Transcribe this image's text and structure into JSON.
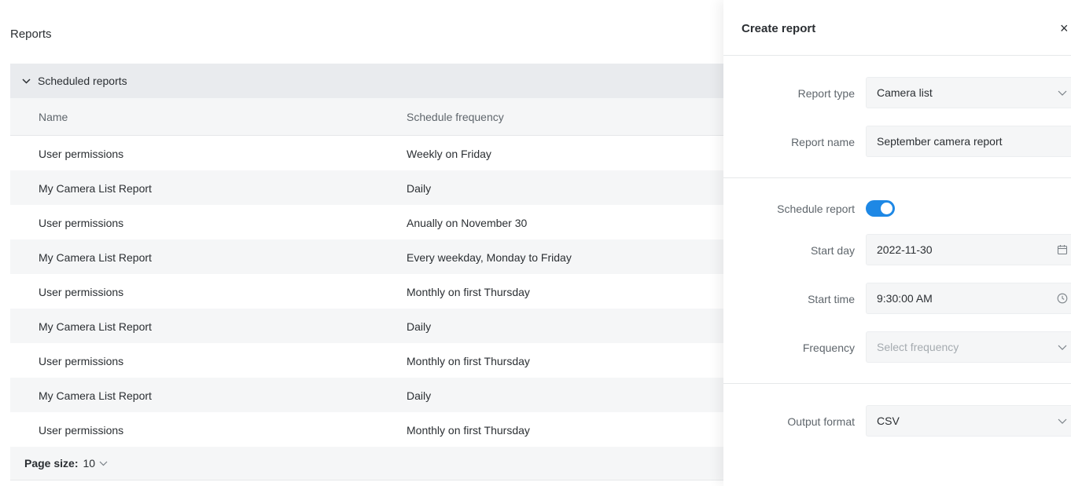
{
  "reports": {
    "title": "Reports",
    "section_title": "Scheduled reports",
    "columns": {
      "name": "Name",
      "frequency": "Schedule frequency"
    },
    "rows": [
      {
        "name": "User permissions",
        "frequency": "Weekly on Friday"
      },
      {
        "name": "My Camera List Report",
        "frequency": "Daily"
      },
      {
        "name": "User permissions",
        "frequency": "Anually on November 30"
      },
      {
        "name": "My Camera List Report",
        "frequency": "Every weekday, Monday to Friday"
      },
      {
        "name": "User permissions",
        "frequency": "Monthly on first Thursday"
      },
      {
        "name": "My Camera List Report",
        "frequency": "Daily"
      },
      {
        "name": "User permissions",
        "frequency": "Monthly on first Thursday"
      },
      {
        "name": "My Camera List Report",
        "frequency": "Daily"
      },
      {
        "name": "User permissions",
        "frequency": "Monthly on first Thursday"
      }
    ],
    "page_size_label": "Page size:",
    "page_size_value": "10"
  },
  "panel": {
    "title": "Create report",
    "close_icon": "×",
    "report_type": {
      "label": "Report type",
      "value": "Camera list",
      "icon": "chevron-down-icon"
    },
    "report_name": {
      "label": "Report name",
      "value": "September camera report"
    },
    "schedule": {
      "label": "Schedule report",
      "enabled": true
    },
    "start_day": {
      "label": "Start day",
      "value": "2022-11-30",
      "icon": "calendar-icon"
    },
    "start_time": {
      "label": "Start time",
      "value": "9:30:00 AM",
      "icon": "clock-icon"
    },
    "frequency": {
      "label": "Frequency",
      "placeholder": "Select frequency",
      "icon": "chevron-down-icon"
    },
    "output_format": {
      "label": "Output format",
      "value": "CSV",
      "icon": "chevron-down-icon"
    }
  },
  "colors": {
    "accent": "#1e88e5",
    "section_header_bg": "#e9ebee",
    "row_alt_bg": "#f5f6f7",
    "text": "#2b2f33",
    "muted_text": "#5f666c",
    "placeholder_text": "#a5abb0"
  }
}
